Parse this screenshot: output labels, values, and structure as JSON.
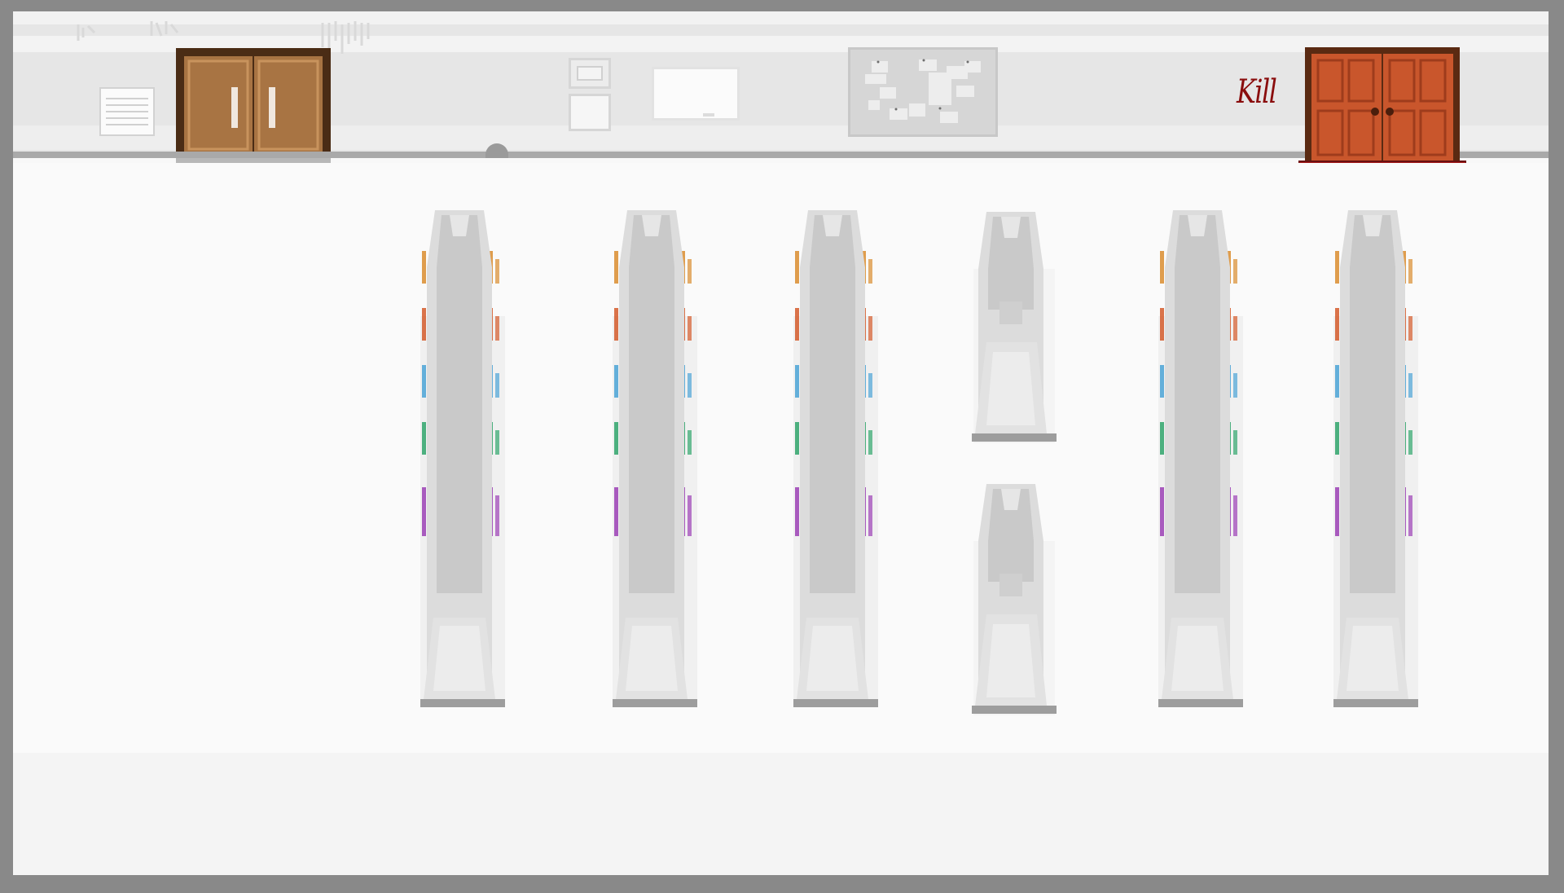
{
  "scene": {
    "name": "church-hall",
    "graffiti_text": "Kill"
  },
  "colors": {
    "wall": "#e6e6e6",
    "floor": "#fafafa",
    "frame": "#898989",
    "wood_door": "#a87443",
    "red_door": "#c9562c",
    "graffiti": "#8a0d0d",
    "book_orange": "#d98c2e",
    "book_red": "#d45a2a",
    "book_blue": "#4aa3d6",
    "book_green": "#2fa56b",
    "book_purple": "#9b3fb5"
  },
  "pews": [
    {
      "id": "pew-1",
      "type": "full"
    },
    {
      "id": "pew-2",
      "type": "full"
    },
    {
      "id": "pew-3",
      "type": "full"
    },
    {
      "id": "pew-4",
      "type": "split"
    },
    {
      "id": "pew-5",
      "type": "full"
    },
    {
      "id": "pew-6",
      "type": "full"
    }
  ],
  "icons": [
    "vent-icon",
    "wooden-door-icon",
    "red-door-icon",
    "picture-frame-icon",
    "whiteboard-icon",
    "bulletin-board-icon",
    "doorknob-shadow-icon"
  ]
}
